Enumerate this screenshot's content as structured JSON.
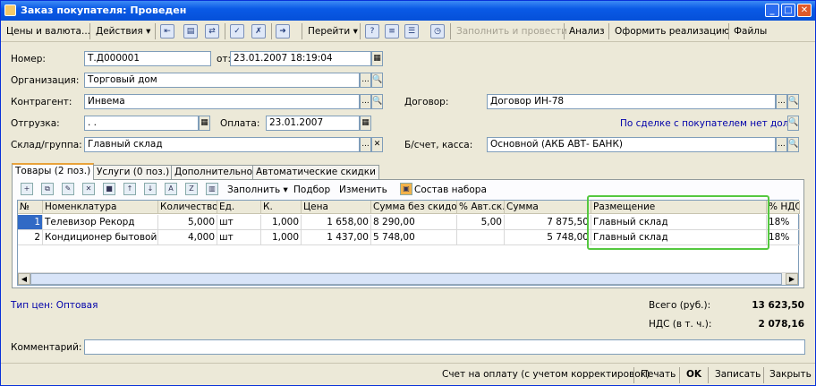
{
  "window": {
    "title": "Заказ покупателя: Проведен",
    "minimize": "_",
    "maximize": "□",
    "close": "✕"
  },
  "toolbar": {
    "prices_currency": "Цены и валюта...",
    "actions": "Действия",
    "goto": "Перейти",
    "help_icon": "?",
    "fill_and_post": "Заполнить и провести",
    "analysis": "Анализ",
    "make_sale": "Оформить реализацию",
    "files": "Файлы",
    "dropdown_glyph": "▾"
  },
  "header": {
    "number_label": "Номер:",
    "number_value": "Т.Д000001",
    "date_label": "от:",
    "date_value": "23.01.2007 18:19:04",
    "organization_label": "Организация:",
    "organization_value": "Торговый дом",
    "counterparty_label": "Контрагент:",
    "counterparty_value": "Инвема",
    "contract_label": "Договор:",
    "contract_value": "Договор ИН-78",
    "shipment_label": "Отгрузка:",
    "shipment_value": ".   .",
    "payment_label": "Оплата:",
    "payment_value": "23.01.2007",
    "debt_link": "По сделке с покупателем нет долга",
    "warehouse_label": "Склад/группа:",
    "warehouse_value": "Главный склад",
    "account_label": "Б/счет, касса:",
    "account_value": "Основной  (АКБ АВТ- БАНК)"
  },
  "field_buttons": {
    "ellipsis": "...",
    "search": "🔍",
    "clear": "✕",
    "calendar": "▦"
  },
  "tabs": [
    {
      "label": "Товары (2 поз.)"
    },
    {
      "label": "Услуги (0 поз.)"
    },
    {
      "label": "Дополнительно"
    },
    {
      "label": "Автоматические скидки"
    }
  ],
  "grid_toolbar": {
    "fill": "Заполнить",
    "selection": "Подбор",
    "change": "Изменить",
    "kit": "Состав набора"
  },
  "table": {
    "columns": [
      "№",
      "Номенклатура",
      "Количество",
      "Ед.",
      "К.",
      "Цена",
      "Сумма без скидок",
      "% Авт.ск.",
      "Сумма",
      "Размещение",
      "% НДС"
    ],
    "rows": [
      [
        "1",
        "Телевизор Рекорд",
        "5,000",
        "шт",
        "1,000",
        "1 658,00",
        "8 290,00",
        "5,00",
        "7 875,50",
        "Главный склад",
        "18%"
      ],
      [
        "2",
        "Кондиционер бытовой",
        "4,000",
        "шт",
        "1,000",
        "1 437,00",
        "5 748,00",
        "",
        "5 748,00",
        "Главный склад",
        "18%"
      ]
    ]
  },
  "footer": {
    "price_type": "Тип цен: Оптовая",
    "total_label": "Всего (руб.):",
    "total_value": "13 623,50",
    "vat_label": "НДС (в т. ч.):",
    "vat_value": "2 078,16",
    "comment_label": "Комментарий:",
    "comment_value": ""
  },
  "statusbar": {
    "invoice": "Счет на оплату (с учетом корректировок)",
    "print": "Печать",
    "ok": "OK",
    "save": "Записать",
    "close": "Закрыть"
  },
  "colors": {
    "title_bar": "#0550d9",
    "highlight_frame": "#55c840",
    "link": "#0000aa"
  }
}
